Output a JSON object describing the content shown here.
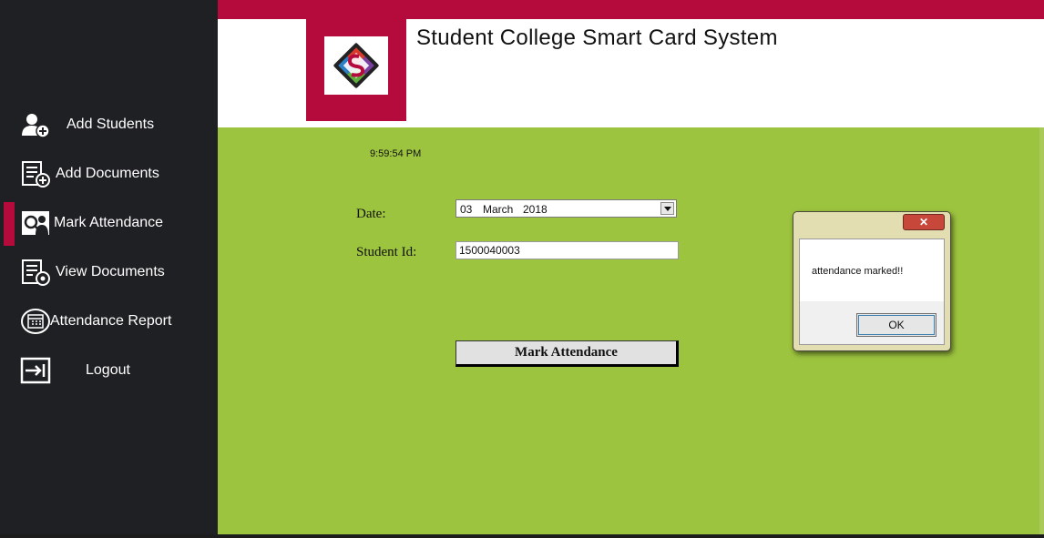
{
  "header": {
    "title": "Student College Smart Card System"
  },
  "sidebar": {
    "items": [
      {
        "label": "Add Students",
        "icon": "add-user-icon",
        "active": false
      },
      {
        "label": "Add Documents",
        "icon": "add-document-icon",
        "active": false
      },
      {
        "label": "Mark Attendance",
        "icon": "attendance-icon",
        "active": true
      },
      {
        "label": "View Documents",
        "icon": "view-document-icon",
        "active": false
      },
      {
        "label": "Attendance Report",
        "icon": "calendar-icon",
        "active": false
      },
      {
        "label": "Logout",
        "icon": "logout-icon",
        "active": false
      }
    ]
  },
  "main": {
    "clock": "9:59:54 PM",
    "date_label": "Date:",
    "date_value": {
      "day": "03",
      "month": "March",
      "year": "2018"
    },
    "student_id_label": "Student Id:",
    "student_id_value": "1500040003",
    "mark_button_label": "Mark Attendance"
  },
  "dialog": {
    "message": "attendance marked!!",
    "ok_label": "OK",
    "close_glyph": "✕"
  },
  "colors": {
    "accent": "#b40b3c",
    "sidebar_bg": "#1f2023",
    "content_bg": "#9dc43f"
  }
}
